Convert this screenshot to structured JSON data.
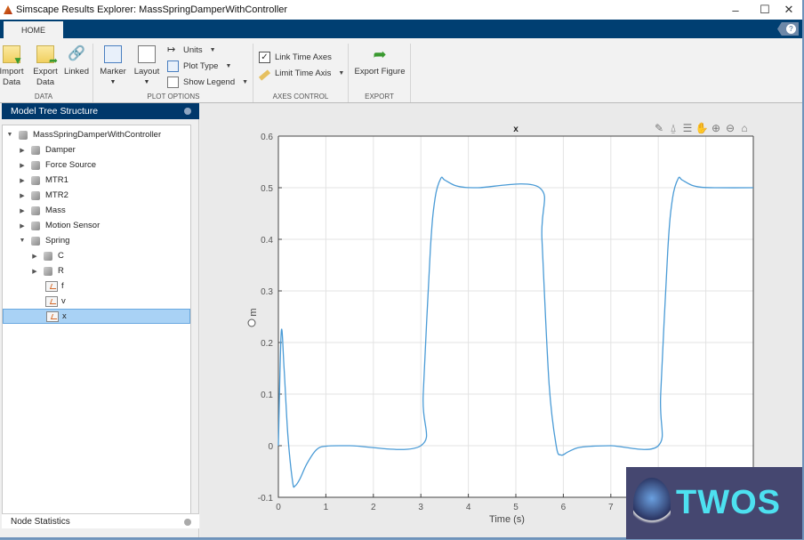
{
  "window": {
    "title": "Simscape Results Explorer: MassSpringDamperWithController",
    "controls": [
      "minimize",
      "maximize",
      "close"
    ]
  },
  "tabs": [
    {
      "label": "HOME",
      "active": true
    }
  ],
  "help_icon": "help-icon",
  "ribbon": {
    "sections": [
      {
        "caption": "DATA",
        "buttons": [
          {
            "label1": "Import",
            "label2": "Data",
            "icon": "import-data-icon"
          },
          {
            "label1": "Export",
            "label2": "Data",
            "icon": "export-data-icon"
          },
          {
            "label1": "Linked",
            "label2": "",
            "icon": "link-icon"
          }
        ]
      },
      {
        "caption": "PLOT OPTIONS",
        "buttons": [
          {
            "label1": "Marker",
            "icon": "marker-icon"
          },
          {
            "label1": "Layout",
            "icon": "layout-icon"
          }
        ],
        "small": [
          {
            "label": "Units",
            "icon": "units-icon"
          },
          {
            "label": "Plot Type",
            "icon": "plot-type-icon"
          },
          {
            "label": "Show Legend",
            "icon": "legend-icon"
          }
        ]
      },
      {
        "caption": "AXES CONTROL",
        "small": [
          {
            "label": "Link Time Axes",
            "checked": true
          },
          {
            "label": "Limit Time Axis",
            "icon": "ruler-icon"
          }
        ]
      },
      {
        "caption": "EXPORT",
        "buttons": [
          {
            "label1": "Export Figure",
            "icon": "export-figure-icon"
          }
        ]
      }
    ]
  },
  "left_panel": {
    "title": "Model Tree Structure",
    "tree": [
      {
        "label": "MassSpringDamperWithController",
        "level": 0,
        "expanded": true,
        "type": "block"
      },
      {
        "label": "Damper",
        "level": 1,
        "expanded": false,
        "type": "block"
      },
      {
        "label": "Force Source",
        "level": 1,
        "expanded": false,
        "type": "block"
      },
      {
        "label": "MTR1",
        "level": 1,
        "expanded": false,
        "type": "block"
      },
      {
        "label": "MTR2",
        "level": 1,
        "expanded": false,
        "type": "block"
      },
      {
        "label": "Mass",
        "level": 1,
        "expanded": false,
        "type": "block"
      },
      {
        "label": "Motion Sensor",
        "level": 1,
        "expanded": false,
        "type": "block"
      },
      {
        "label": "Spring",
        "level": 1,
        "expanded": true,
        "type": "block"
      },
      {
        "label": "C",
        "level": 2,
        "expanded": false,
        "type": "block"
      },
      {
        "label": "R",
        "level": 2,
        "expanded": false,
        "type": "block"
      },
      {
        "label": "f",
        "level": 2,
        "type": "signal"
      },
      {
        "label": "v",
        "level": 2,
        "type": "signal"
      },
      {
        "label": "x",
        "level": 2,
        "type": "signal",
        "selected": true
      }
    ],
    "bottom_title": "Node Statistics"
  },
  "plot_toolbar": [
    "brush-icon",
    "data-tip-icon",
    "legend-icon",
    "pan-icon",
    "zoom-in-icon",
    "zoom-out-icon",
    "home-icon"
  ],
  "chart_data": {
    "type": "line",
    "title": "x",
    "xlabel": "Time (s)",
    "ylabel": "m",
    "xlim": [
      0,
      10
    ],
    "ylim": [
      -0.1,
      0.6
    ],
    "xticks": [
      0,
      1,
      2,
      3,
      4,
      5,
      6,
      7,
      8,
      9,
      10
    ],
    "xtick_labels": [
      "0",
      "1",
      "2",
      "3",
      "4",
      "5",
      "6",
      "7",
      "",
      "",
      ""
    ],
    "yticks": [
      -0.1,
      0,
      0.1,
      0.2,
      0.3,
      0.4,
      0.5,
      0.6
    ],
    "ytick_labels": [
      "-0.1",
      "0",
      "0.1",
      "0.2",
      "0.3",
      "0.4",
      "0.5",
      "0.6"
    ],
    "grid": true,
    "series": [
      {
        "name": "x",
        "color": "#4a9bd6",
        "x": [
          0,
          0.06,
          0.12,
          0.2,
          0.3,
          0.35,
          0.45,
          0.6,
          0.8,
          1.0,
          1.5,
          3.0,
          3.05,
          3.2,
          3.3,
          3.42,
          3.5,
          3.7,
          3.9,
          4.2,
          5.5,
          5.55,
          5.7,
          5.85,
          5.95,
          6.1,
          6.3,
          6.6,
          7.0,
          8.0,
          8.05,
          8.2,
          8.3,
          8.42,
          8.5,
          8.7,
          8.9,
          9.2,
          10.0
        ],
        "y": [
          0,
          0.22,
          0.15,
          0.02,
          -0.07,
          -0.078,
          -0.065,
          -0.035,
          -0.008,
          -0.001,
          0,
          0,
          0.1,
          0.38,
          0.48,
          0.518,
          0.515,
          0.505,
          0.501,
          0.5,
          0.5,
          0.4,
          0.12,
          0.0,
          -0.018,
          -0.012,
          -0.004,
          -0.001,
          0,
          0,
          0.1,
          0.38,
          0.48,
          0.518,
          0.515,
          0.505,
          0.501,
          0.5,
          0.5
        ]
      }
    ]
  },
  "watermark": {
    "text": "TWOS"
  }
}
